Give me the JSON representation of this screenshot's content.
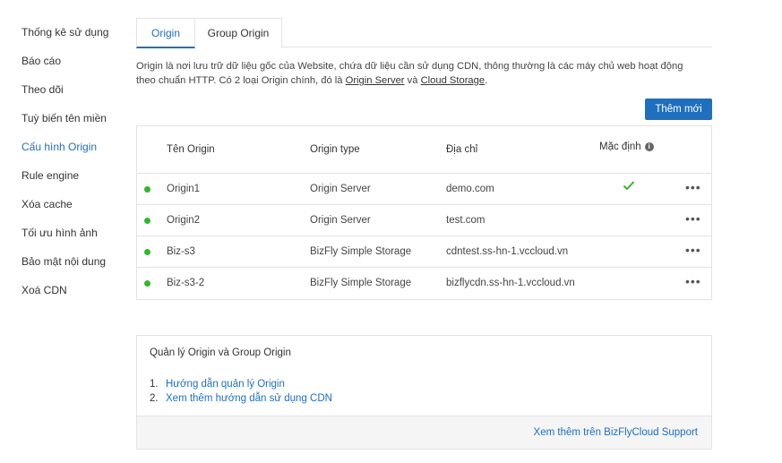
{
  "sidebar": {
    "items": [
      {
        "label": "Thống kê sử dụng",
        "active": false
      },
      {
        "label": "Báo cáo",
        "active": false
      },
      {
        "label": "Theo dõi",
        "active": false
      },
      {
        "label": "Tuỳ biến tên miền",
        "active": false
      },
      {
        "label": "Cấu hình Origin",
        "active": true
      },
      {
        "label": "Rule engine",
        "active": false
      },
      {
        "label": "Xóa cache",
        "active": false
      },
      {
        "label": "Tối ưu hình ảnh",
        "active": false
      },
      {
        "label": "Bảo mật nội dung",
        "active": false
      },
      {
        "label": "Xoá CDN",
        "active": false
      }
    ]
  },
  "tabs": [
    {
      "label": "Origin",
      "active": true
    },
    {
      "label": "Group Origin",
      "active": false
    }
  ],
  "description": {
    "text_1": "Origin là nơi lưu trữ dữ liệu gốc của Website, chứa dữ liệu cần sử dụng CDN, thông thường là các máy chủ web hoạt động theo chuẩn HTTP. Có 2 loại Origin chính, đó là ",
    "link_1": "Origin Server",
    "text_2": " và ",
    "link_2": "Cloud Storage",
    "text_3": "."
  },
  "add_button": "Thêm mới",
  "table": {
    "headers": {
      "name": "Tên Origin",
      "type": "Origin type",
      "address": "Địa chỉ",
      "default": "Mặc định"
    },
    "rows": [
      {
        "name": "Origin1",
        "type": "Origin Server",
        "address": "demo.com",
        "default": true
      },
      {
        "name": "Origin2",
        "type": "Origin Server",
        "address": "test.com",
        "default": false
      },
      {
        "name": "Biz-s3",
        "type": "BizFly Simple Storage",
        "address": "cdntest.ss-hn-1.vccloud.vn",
        "default": false
      },
      {
        "name": "Biz-s3-2",
        "type": "BizFly Simple Storage",
        "address": "bizflycdn.ss-hn-1.vccloud.vn",
        "default": false
      }
    ],
    "more_label": "•••",
    "status_color": "#2eb82e",
    "check_color": "#2eb82e"
  },
  "guide": {
    "title": "Quản lý Origin và Group Origin",
    "items": [
      {
        "num": "1.",
        "label": "Hướng dẫn quản lý Origin"
      },
      {
        "num": "2.",
        "label": "Xem thêm hướng dẫn sử dụng CDN"
      }
    ],
    "footer_link": "Xem thêm trên BizFlyCloud Support"
  },
  "colors": {
    "accent": "#1f6fbf",
    "border": "#e3e3e3",
    "footer_bg": "#f5f5f5"
  }
}
